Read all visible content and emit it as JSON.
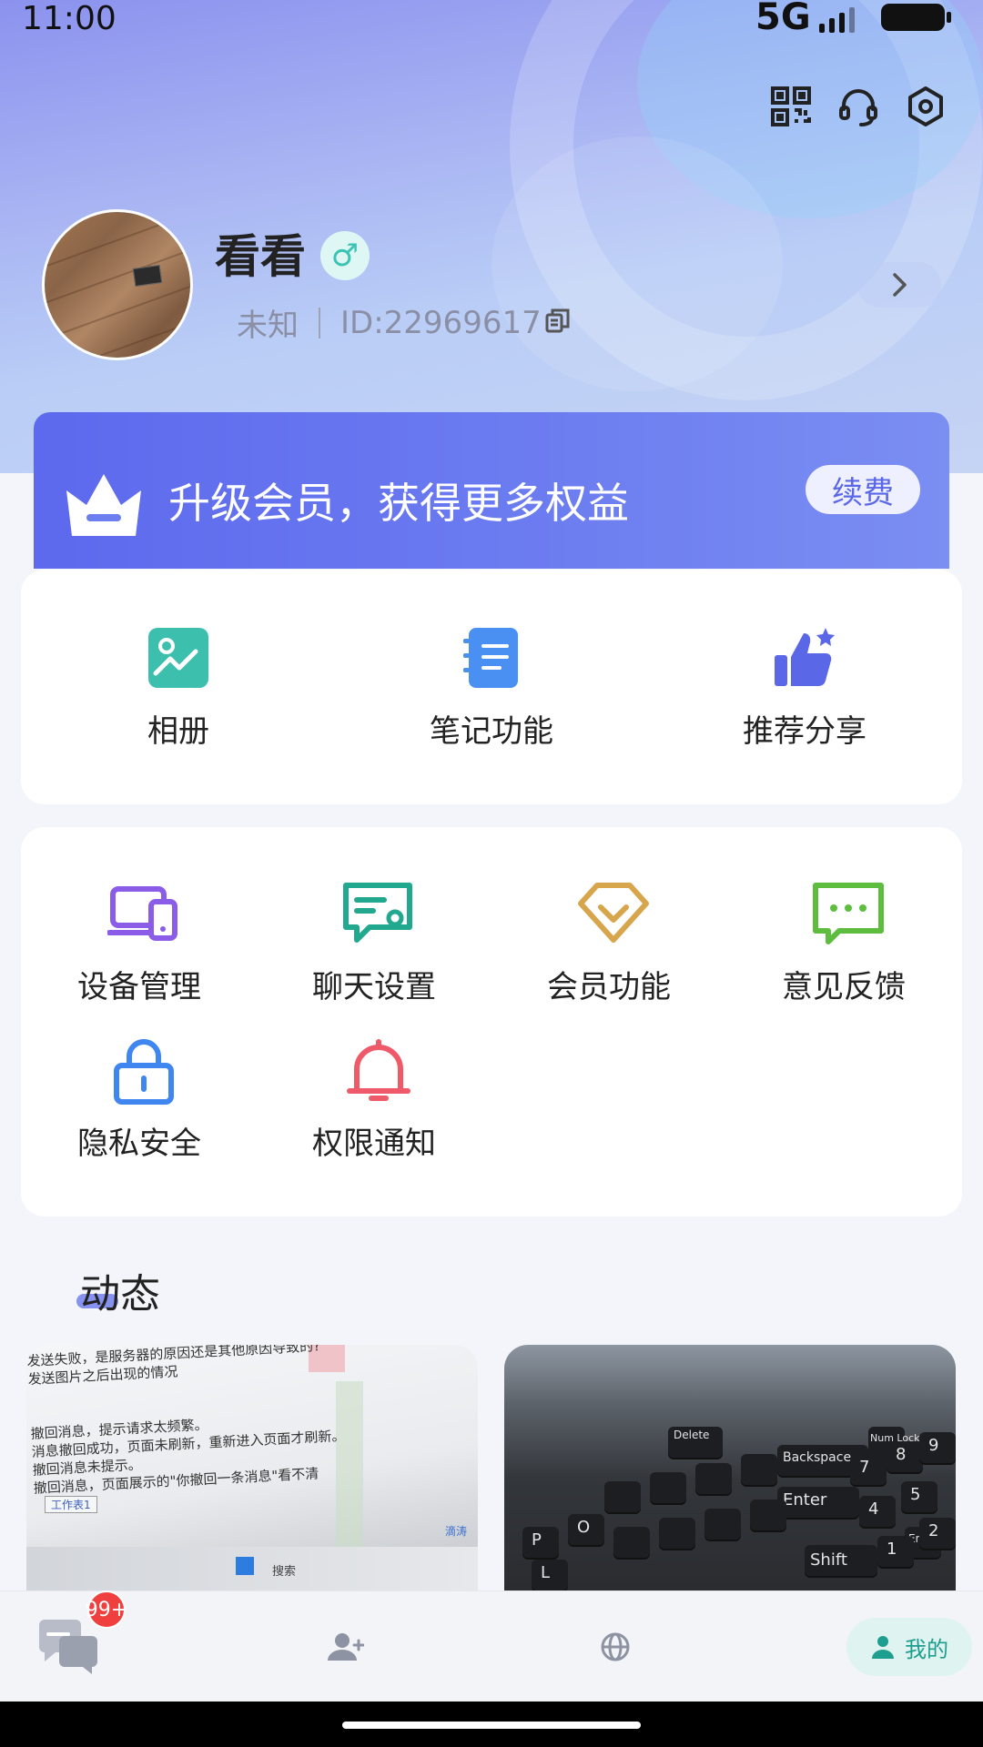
{
  "status_bar": {
    "time": "11:00",
    "network": "5G"
  },
  "profile": {
    "name": "看看",
    "gender_symbol": "♂",
    "region": "未知",
    "id_text": "ID:22969617"
  },
  "vip_banner": {
    "title": "升级会员，获得更多权益",
    "renew_label": "续费"
  },
  "primary_features": [
    {
      "label": "相册",
      "icon": "album-icon"
    },
    {
      "label": "笔记功能",
      "icon": "notes-icon"
    },
    {
      "label": "推荐分享",
      "icon": "thumbs-up-icon"
    }
  ],
  "settings_grid": [
    {
      "label": "设备管理",
      "icon": "devices-icon"
    },
    {
      "label": "聊天设置",
      "icon": "chat-settings-icon"
    },
    {
      "label": "会员功能",
      "icon": "diamond-icon"
    },
    {
      "label": "意见反馈",
      "icon": "feedback-icon"
    },
    {
      "label": "隐私安全",
      "icon": "lock-icon"
    },
    {
      "label": "权限通知",
      "icon": "bell-icon"
    }
  ],
  "moments": {
    "title": "动态",
    "posts": [
      {
        "type": "photo",
        "lines": [
          "发送失败，是服务器的原因还是其他原因导致的?",
          "发送图片之后出现的情况",
          "撤回消息，提示请求太频繁。",
          "消息撤回成功，页面未刷新，重新进入页面才刷新。",
          "撤回消息未提示。",
          "撤回消息，页面展示的\"你撤回一条消息\"看不清"
        ],
        "taskbar_search": "搜索",
        "sheet_tab": "工作表1",
        "tag": "滴涛"
      },
      {
        "type": "photo",
        "keys": [
          "Delete",
          "Backspace",
          "Enter",
          "Shift",
          "End",
          "Num Lock",
          "P",
          "O",
          "L",
          "7",
          "8",
          "9",
          "4",
          "5",
          "1",
          "2"
        ]
      }
    ]
  },
  "tabbar": {
    "badge": "99+",
    "mine_label": "我的"
  },
  "colors": {
    "accent": "#5d69ee",
    "teal": "#1d9e8e",
    "badge": "#ef3f3f"
  }
}
